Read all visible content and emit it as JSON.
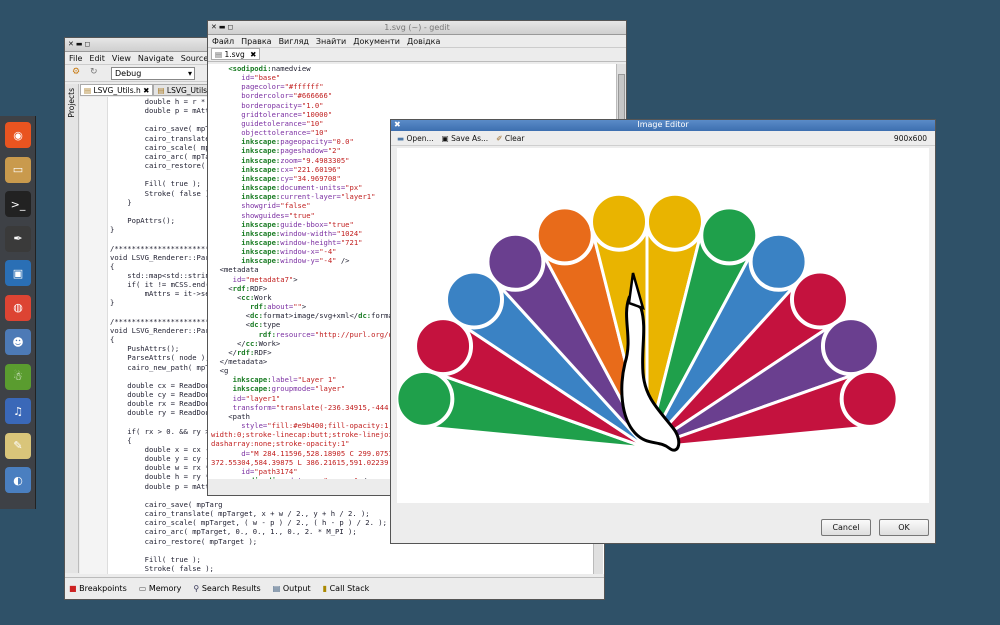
{
  "dock": {
    "items": [
      {
        "name": "ubuntu-icon",
        "glyph": "◉",
        "color": "#e95420"
      },
      {
        "name": "files-icon",
        "glyph": "▭",
        "color": "#c99a4d"
      },
      {
        "name": "terminal-icon",
        "glyph": ">_",
        "color": "#222222"
      },
      {
        "name": "inkscape-icon",
        "glyph": "✒",
        "color": "#3a3a3a"
      },
      {
        "name": "virtualbox-icon",
        "glyph": "▣",
        "color": "#2a6fb5"
      },
      {
        "name": "chrome-icon",
        "glyph": "◍",
        "color": "#dd4433"
      },
      {
        "name": "bug-icon",
        "glyph": "☻",
        "color": "#4d7ab6"
      },
      {
        "name": "android-icon",
        "glyph": "☃",
        "color": "#5a9c2f"
      },
      {
        "name": "music-icon",
        "glyph": "♫",
        "color": "#3a68b8"
      },
      {
        "name": "editor-icon",
        "glyph": "✎",
        "color": "#d9c57a"
      },
      {
        "name": "firefox-icon",
        "glyph": "◐",
        "color": "#4a7fc0"
      }
    ]
  },
  "ide": {
    "menus": [
      "File",
      "Edit",
      "View",
      "Navigate",
      "Source",
      "Re"
    ],
    "build_config": "Debug",
    "tabs": [
      "LSVG_Utils.h",
      "LSVG_Utils"
    ],
    "sidebar_label": "Projects",
    "code_lines": [
      "        double h = r * 2.;",
      "        double p = mAttrs",
      "",
      "        cairo_save( mpTarg",
      "        cairo_translate( m",
      "        cairo_scale( mpTar",
      "        cairo_arc( mpTarge",
      "        cairo_restore( mpT",
      "",
      "        Fill( true );",
      "        Stroke( false );",
      "    }",
      "",
      "    PopAttrs();",
      "}",
      "",
      "/*****************************",
      "void LSVG_Renderer::ParseE",
      "{",
      "    std::map<std::string,",
      "    if( it != mCSS.end()",
      "        mAttrs = it->sec",
      "}",
      "",
      "/*****************************",
      "void LSVG_Renderer::ParseR",
      "{",
      "    PushAttrs();",
      "    ParseAttrs( node );",
      "    cairo_new_path( mpTarg",
      "",
      "    double cx = ReadDoubl",
      "    double cy = ReadDoubl",
      "    double rx = ReadDoubl",
      "    double ry = ReadDoubl",
      "",
      "    if( rx > 0. && ry > 0.",
      "    {",
      "        double x = cx -",
      "        double y = cy -",
      "        double w = rx *",
      "        double h = ry *",
      "        double p = mAttrs",
      "",
      "        cairo_save( mpTarg",
      "        cairo_translate( mpTarget, x + w / 2., y + h / 2. );",
      "        cairo_scale( mpTarget, ( w - p ) / 2., ( h - p ) / 2. );",
      "        cairo_arc( mpTarget, 0., 0., 1., 0., 2. * M_PI );",
      "        cairo_restore( mpTarget );",
      "",
      "        Fill( true );",
      "        Stroke( false );",
      "    }",
      "",
      "    PopAttrs();"
    ],
    "bottom_tabs": [
      {
        "icon": "breakpoints-icon",
        "label": "Breakpoints"
      },
      {
        "icon": "memory-icon",
        "label": "Memory"
      },
      {
        "icon": "search-icon",
        "label": "Search Results"
      },
      {
        "icon": "output-icon",
        "label": "Output"
      },
      {
        "icon": "callstack-icon",
        "label": "Call Stack"
      }
    ]
  },
  "gedit": {
    "title": "1.svg (~) - gedit",
    "menus": [
      "Файл",
      "Правка",
      "Вигляд",
      "Знайти",
      "Документи",
      "Довідка"
    ],
    "tab": "1.svg",
    "lines": [
      [
        [
          "    ",
          "t"
        ],
        [
          "<sodipodi:",
          "k"
        ],
        [
          "namedview",
          "t"
        ]
      ],
      [
        [
          "       id=",
          "a"
        ],
        [
          "\"base\"",
          "s"
        ]
      ],
      [
        [
          "       pagecolor=",
          "a"
        ],
        [
          "\"#ffffff\"",
          "s"
        ]
      ],
      [
        [
          "       bordercolor=",
          "a"
        ],
        [
          "\"#666666\"",
          "s"
        ]
      ],
      [
        [
          "       borderopacity=",
          "a"
        ],
        [
          "\"1.0\"",
          "s"
        ]
      ],
      [
        [
          "       gridtolerance=",
          "a"
        ],
        [
          "\"10000\"",
          "s"
        ]
      ],
      [
        [
          "       guidetolerance=",
          "a"
        ],
        [
          "\"10\"",
          "s"
        ]
      ],
      [
        [
          "       objecttolerance=",
          "a"
        ],
        [
          "\"10\"",
          "s"
        ]
      ],
      [
        [
          "       ",
          "t"
        ],
        [
          "inkscape:",
          "k"
        ],
        [
          "pageopacity=",
          "a"
        ],
        [
          "\"0.0\"",
          "s"
        ]
      ],
      [
        [
          "       ",
          "t"
        ],
        [
          "inkscape:",
          "k"
        ],
        [
          "pageshadow=",
          "a"
        ],
        [
          "\"2\"",
          "s"
        ]
      ],
      [
        [
          "       ",
          "t"
        ],
        [
          "inkscape:",
          "k"
        ],
        [
          "zoom=",
          "a"
        ],
        [
          "\"9.4983305\"",
          "s"
        ]
      ],
      [
        [
          "       ",
          "t"
        ],
        [
          "inkscape:",
          "k"
        ],
        [
          "cx=",
          "a"
        ],
        [
          "\"221.60196\"",
          "s"
        ]
      ],
      [
        [
          "       ",
          "t"
        ],
        [
          "inkscape:",
          "k"
        ],
        [
          "cy=",
          "a"
        ],
        [
          "\"34.969708\"",
          "s"
        ]
      ],
      [
        [
          "       ",
          "t"
        ],
        [
          "inkscape:",
          "k"
        ],
        [
          "document-units=",
          "a"
        ],
        [
          "\"px\"",
          "s"
        ]
      ],
      [
        [
          "       ",
          "t"
        ],
        [
          "inkscape:",
          "k"
        ],
        [
          "current-layer=",
          "a"
        ],
        [
          "\"layer1\"",
          "s"
        ]
      ],
      [
        [
          "       showgrid=",
          "a"
        ],
        [
          "\"false\"",
          "s"
        ]
      ],
      [
        [
          "       showguides=",
          "a"
        ],
        [
          "\"true\"",
          "s"
        ]
      ],
      [
        [
          "       ",
          "t"
        ],
        [
          "inkscape:",
          "k"
        ],
        [
          "guide-bbox=",
          "a"
        ],
        [
          "\"true\"",
          "s"
        ]
      ],
      [
        [
          "       ",
          "t"
        ],
        [
          "inkscape:",
          "k"
        ],
        [
          "window-width=",
          "a"
        ],
        [
          "\"1024\"",
          "s"
        ]
      ],
      [
        [
          "       ",
          "t"
        ],
        [
          "inkscape:",
          "k"
        ],
        [
          "window-height=",
          "a"
        ],
        [
          "\"721\"",
          "s"
        ]
      ],
      [
        [
          "       ",
          "t"
        ],
        [
          "inkscape:",
          "k"
        ],
        [
          "window-x=",
          "a"
        ],
        [
          "\"-4\"",
          "s"
        ]
      ],
      [
        [
          "       ",
          "t"
        ],
        [
          "inkscape:",
          "k"
        ],
        [
          "window-y=",
          "a"
        ],
        [
          "\"-4\"",
          "s"
        ],
        [
          " />",
          "t"
        ]
      ],
      [
        [
          "  <metadata",
          "t"
        ]
      ],
      [
        [
          "     id=",
          "a"
        ],
        [
          "\"metadata7\"",
          "s"
        ],
        [
          ">",
          "t"
        ]
      ],
      [
        [
          "    <",
          "t"
        ],
        [
          "rdf:",
          "k"
        ],
        [
          "RDF>",
          "t"
        ]
      ],
      [
        [
          "      <",
          "t"
        ],
        [
          "cc:",
          "k"
        ],
        [
          "Work",
          "t"
        ]
      ],
      [
        [
          "         ",
          "t"
        ],
        [
          "rdf:",
          "k"
        ],
        [
          "about=",
          "a"
        ],
        [
          "\"\"",
          "s"
        ],
        [
          ">",
          "t"
        ]
      ],
      [
        [
          "        <",
          "t"
        ],
        [
          "dc:",
          "k"
        ],
        [
          "format>image/svg+xml</",
          "t"
        ],
        [
          "dc:",
          "k"
        ],
        [
          "format>",
          "t"
        ]
      ],
      [
        [
          "        <",
          "t"
        ],
        [
          "dc:",
          "k"
        ],
        [
          "type",
          "t"
        ]
      ],
      [
        [
          "           ",
          "t"
        ],
        [
          "rdf:",
          "k"
        ],
        [
          "resource=",
          "a"
        ],
        [
          "\"http://purl.org/dc",
          "s"
        ]
      ],
      [
        [
          "      </",
          "t"
        ],
        [
          "cc:",
          "k"
        ],
        [
          "Work>",
          "t"
        ]
      ],
      [
        [
          "    </",
          "t"
        ],
        [
          "rdf:",
          "k"
        ],
        [
          "RDF>",
          "t"
        ]
      ],
      [
        [
          "  </metadata>",
          "t"
        ]
      ],
      [
        [
          "  <g",
          "t"
        ]
      ],
      [
        [
          "     ",
          "t"
        ],
        [
          "inkscape:",
          "k"
        ],
        [
          "label=",
          "a"
        ],
        [
          "\"Layer 1\"",
          "s"
        ]
      ],
      [
        [
          "     ",
          "t"
        ],
        [
          "inkscape:",
          "k"
        ],
        [
          "groupmode=",
          "a"
        ],
        [
          "\"layer\"",
          "s"
        ]
      ],
      [
        [
          "     id=",
          "a"
        ],
        [
          "\"layer1\"",
          "s"
        ]
      ],
      [
        [
          "     transform=",
          "a"
        ],
        [
          "\"translate(-236.34915,-444.7",
          "s"
        ]
      ],
      [
        [
          "    <path",
          "t"
        ]
      ],
      [
        [
          "       style=",
          "a"
        ],
        [
          "\"fill:#e9b400;fill-opacity:1;f",
          "s"
        ]
      ],
      [
        [
          "width:0;stroke-linecap:butt;stroke-linejoin",
          "s"
        ]
      ],
      [
        [
          "dasharray:none;stroke-opacity:1\"",
          "s"
        ]
      ],
      [
        [
          "       d=",
          "a"
        ],
        [
          "\"M 284.11596,528.18905 C 299.07512",
          "s"
        ]
      ],
      [
        [
          "372.55304,584.39875 L 386.21615,591.02239 L",
          "s"
        ]
      ],
      [
        [
          "       id=",
          "a"
        ],
        [
          "\"path3174\"",
          "s"
        ]
      ],
      [
        [
          "       ",
          "t"
        ],
        [
          "sodipodi:",
          "k"
        ],
        [
          "nodetypes=",
          "a"
        ],
        [
          "\"cccccc\"",
          "s"
        ],
        [
          " />",
          "t"
        ]
      ]
    ]
  },
  "image_editor": {
    "title": "Image Editor",
    "toolbar": {
      "open": "Open...",
      "save_as": "Save As...",
      "clear": "Clear"
    },
    "size": "900x600",
    "cancel": "Cancel",
    "ok": "OK",
    "peacock_colors": [
      "#e9b400",
      "#6a3f8f",
      "#e86b1a",
      "#3a82c4",
      "#c4123e",
      "#1fa04b"
    ]
  }
}
